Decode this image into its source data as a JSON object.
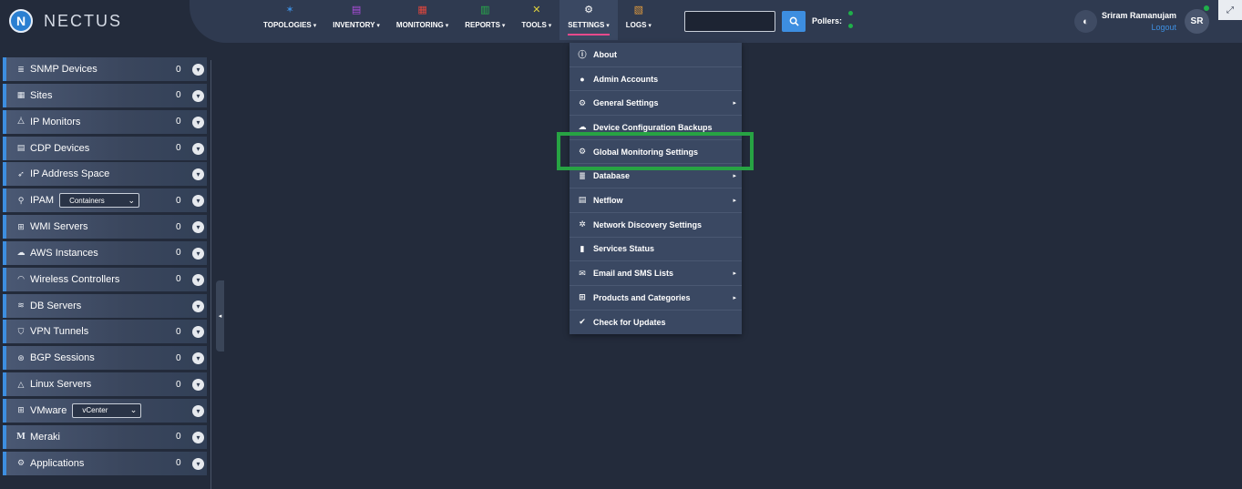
{
  "app": {
    "name": "NECTUS",
    "logo_letter": "N"
  },
  "nav": [
    {
      "label": "TOPOLOGIES",
      "icon": "topology-icon",
      "color": "#3d8ee0"
    },
    {
      "label": "INVENTORY",
      "icon": "inventory-icon",
      "color": "#b04ee0"
    },
    {
      "label": "MONITORING",
      "icon": "monitoring-icon",
      "color": "#e0463d"
    },
    {
      "label": "REPORTS",
      "icon": "reports-icon",
      "color": "#27b04a"
    },
    {
      "label": "TOOLS",
      "icon": "tools-icon",
      "color": "#e0d23d"
    },
    {
      "label": "SETTINGS",
      "icon": "settings-gears-icon",
      "color": "#ffffff",
      "active": true
    },
    {
      "label": "LOGS",
      "icon": "logs-icon",
      "color": "#e09a3d"
    }
  ],
  "search": {
    "value": "",
    "placeholder": ""
  },
  "pollers_label": "Pollers:",
  "user": {
    "name": "Sriram Ramanujam",
    "logout": "Logout",
    "initials": "SR"
  },
  "sidebar": [
    {
      "label": "SNMP Devices",
      "icon": "server-stack-icon",
      "count": "0"
    },
    {
      "label": "Sites",
      "icon": "building-icon",
      "count": "0"
    },
    {
      "label": "IP Monitors",
      "icon": "network-icon",
      "count": "0"
    },
    {
      "label": "CDP Devices",
      "icon": "device-list-icon",
      "count": "0"
    },
    {
      "label": "IP Address Space",
      "icon": "rocket-icon",
      "count": ""
    },
    {
      "label": "IPAM",
      "icon": "map-pin-icon",
      "count": "0",
      "select": "Containers"
    },
    {
      "label": "WMI Servers",
      "icon": "windows-icon",
      "count": "0"
    },
    {
      "label": "AWS Instances",
      "icon": "cloud-icon",
      "count": "0"
    },
    {
      "label": "Wireless Controllers",
      "icon": "wifi-icon",
      "count": "0"
    },
    {
      "label": "DB Servers",
      "icon": "database-icon",
      "count": ""
    },
    {
      "label": "VPN Tunnels",
      "icon": "shield-icon",
      "count": "0"
    },
    {
      "label": "BGP Sessions",
      "icon": "hub-icon",
      "count": "0"
    },
    {
      "label": "Linux Servers",
      "icon": "linux-icon",
      "count": "0"
    },
    {
      "label": "VMware",
      "icon": "vmware-icon",
      "count": "",
      "select": "vCenter"
    },
    {
      "label": "Meraki",
      "icon": "meraki-icon",
      "count": "0"
    },
    {
      "label": "Applications",
      "icon": "app-gear-icon",
      "count": "0"
    }
  ],
  "settings_menu": [
    {
      "label": "About",
      "icon": "info-icon",
      "submenu": false
    },
    {
      "label": "Admin Accounts",
      "icon": "user-icon",
      "submenu": false
    },
    {
      "label": "General Settings",
      "icon": "gears-icon",
      "submenu": true
    },
    {
      "label": "Device Configuration Backups",
      "icon": "backup-icon",
      "submenu": false
    },
    {
      "label": "Global Monitoring Settings",
      "icon": "gears-icon",
      "submenu": false,
      "highlighted": true
    },
    {
      "label": "Database",
      "icon": "database-icon",
      "submenu": true
    },
    {
      "label": "Netflow",
      "icon": "netflow-icon",
      "submenu": true
    },
    {
      "label": "Network Discovery Settings",
      "icon": "discovery-icon",
      "submenu": false
    },
    {
      "label": "Services Status",
      "icon": "bar-chart-icon",
      "submenu": false
    },
    {
      "label": "Email and SMS Lists",
      "icon": "envelope-icon",
      "submenu": true
    },
    {
      "label": "Products and Categories",
      "icon": "gift-icon",
      "submenu": true
    },
    {
      "label": "Check for Updates",
      "icon": "check-circle-icon",
      "submenu": false
    }
  ],
  "colors": {
    "accent": "#3d8ee0",
    "highlight": "#27a343",
    "active_underline": "#e64a8c"
  }
}
